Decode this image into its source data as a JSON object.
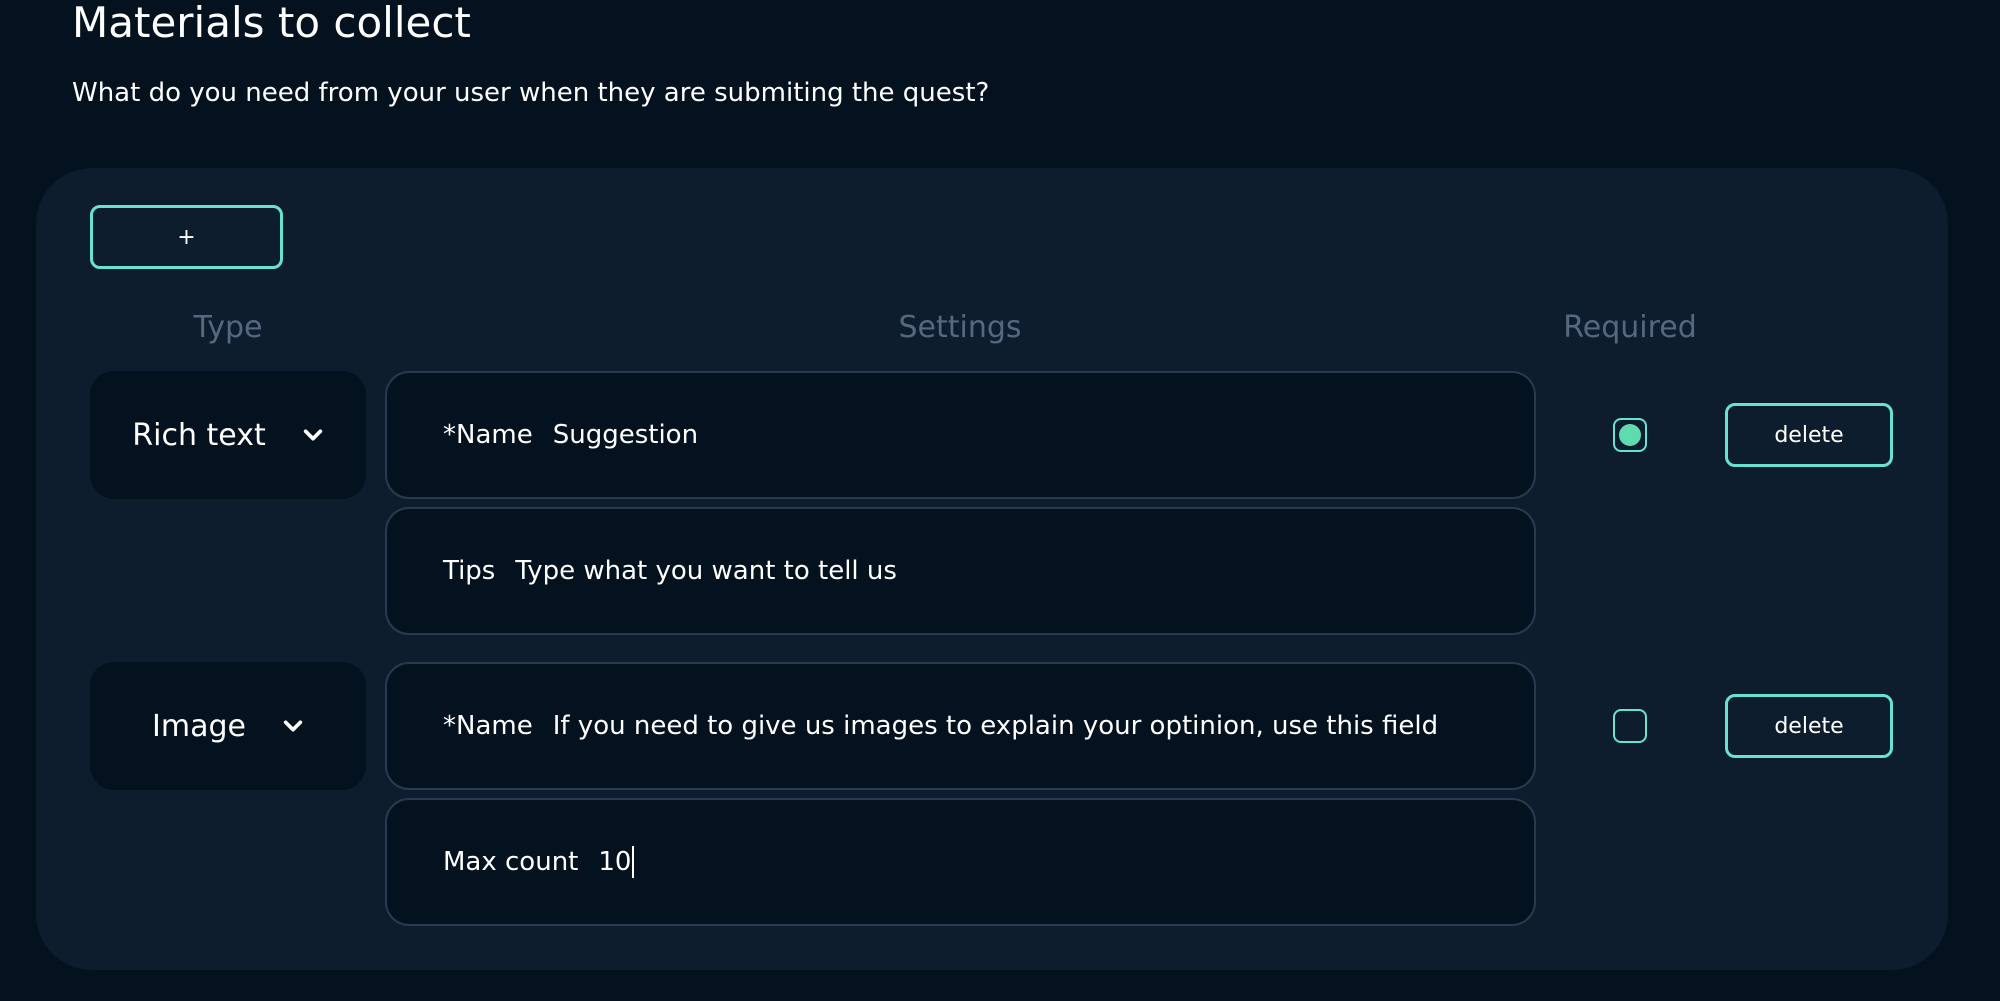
{
  "header": {
    "title": "Materials to collect",
    "subtitle": "What do you need from your user when they are submiting the quest?"
  },
  "toolbar": {
    "add_label": "+"
  },
  "columns": {
    "type": "Type",
    "settings": "Settings",
    "required": "Required"
  },
  "rows": [
    {
      "type_label": "Rich text",
      "settings": [
        {
          "label": "*Name",
          "value": "Suggestion"
        },
        {
          "label": "Tips",
          "value": "Type what you want to tell us"
        }
      ],
      "required": true,
      "delete_label": "delete"
    },
    {
      "type_label": "Image",
      "settings": [
        {
          "label": "*Name",
          "value": "If you need to give us images to explain your optinion, use this field"
        },
        {
          "label": "Max count",
          "value": "10"
        }
      ],
      "required": false,
      "delete_label": "delete"
    }
  ],
  "colors": {
    "background": "#041220",
    "panel": "#0d1d2e",
    "accent": "#67e3d5",
    "checked": "#5fdcae",
    "muted_header": "#55687f"
  },
  "icons": {
    "type_dropdown": "chevron-down-icon",
    "checkbox_checked": "filled-dot-icon"
  }
}
